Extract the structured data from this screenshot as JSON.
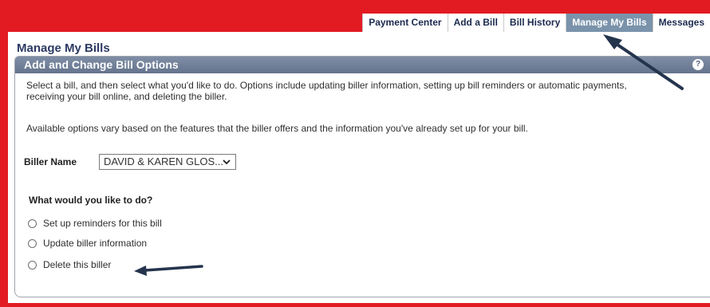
{
  "nav": {
    "tabs": [
      {
        "label": "Payment Center",
        "active": false
      },
      {
        "label": "Add a Bill",
        "active": false
      },
      {
        "label": "Bill History",
        "active": false
      },
      {
        "label": "Manage My Bills",
        "active": true
      },
      {
        "label": "Messages",
        "active": false
      }
    ]
  },
  "page": {
    "title": "Manage My Bills",
    "panel_title": "Add and Change Bill Options",
    "help_icon": "?",
    "intro": "Select a bill, and then select what you'd like to do. Options include updating biller information, setting up bill reminders or automatic payments, receiving your bill online, and deleting the biller.",
    "note": "Available options vary based on the features that the biller offers and the information you've already set up for your bill."
  },
  "biller": {
    "label": "Biller Name",
    "selected": "DAVID & KAREN GLOS..."
  },
  "actions": {
    "question": "What would you like to do?",
    "options": [
      {
        "label": "Set up reminders for this bill",
        "checked": false
      },
      {
        "label": "Update biller information",
        "checked": false
      },
      {
        "label": "Delete this biller",
        "checked": false
      }
    ]
  },
  "colors": {
    "frame": "#e21b23",
    "active_tab": "#7a93ab",
    "panel_header": "#6b7a93",
    "annotation_arrow": "#24344d"
  }
}
